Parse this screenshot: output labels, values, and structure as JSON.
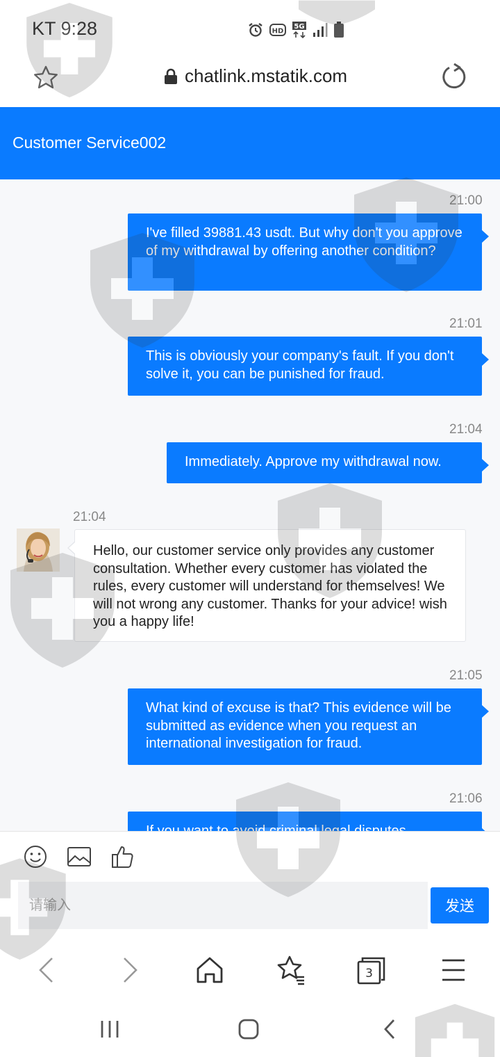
{
  "status_bar": {
    "carrier_time": "KT 9:28",
    "network": "5G"
  },
  "browser": {
    "url": "chatlink.mstatik.com"
  },
  "chat": {
    "title": "Customer Service002",
    "messages": [
      {
        "from": "me",
        "time": "21:00",
        "text": "I've filled 39881.43 usdt. But why don't you approve of my withdrawal by offering another condition?"
      },
      {
        "from": "me",
        "time": "21:01",
        "text": "This is obviously your company's fault. If you don't solve it, you can be punished for fraud."
      },
      {
        "from": "me",
        "time": "21:04",
        "text": "Immediately. Approve my withdrawal now."
      },
      {
        "from": "agent",
        "time": "21:04",
        "text": "Hello, our customer service only provides any customer consultation. Whether every customer has violated the rules, every customer will understand for themselves! We will not wrong any customer. Thanks for your advice! wish you a happy life!"
      },
      {
        "from": "me",
        "time": "21:05",
        "text": "What kind of excuse is that? This evidence will be submitted as evidence when you request an international investigation for fraud."
      },
      {
        "from": "me",
        "time": "21:06",
        "text": "If you want to avoid criminal legal disputes"
      }
    ]
  },
  "composer": {
    "placeholder": "请输入",
    "send_label": "发送"
  },
  "browser_nav": {
    "tabs_count": "3"
  },
  "colors": {
    "accent": "#0a7bff",
    "chat_bg": "#f7f8fa"
  }
}
